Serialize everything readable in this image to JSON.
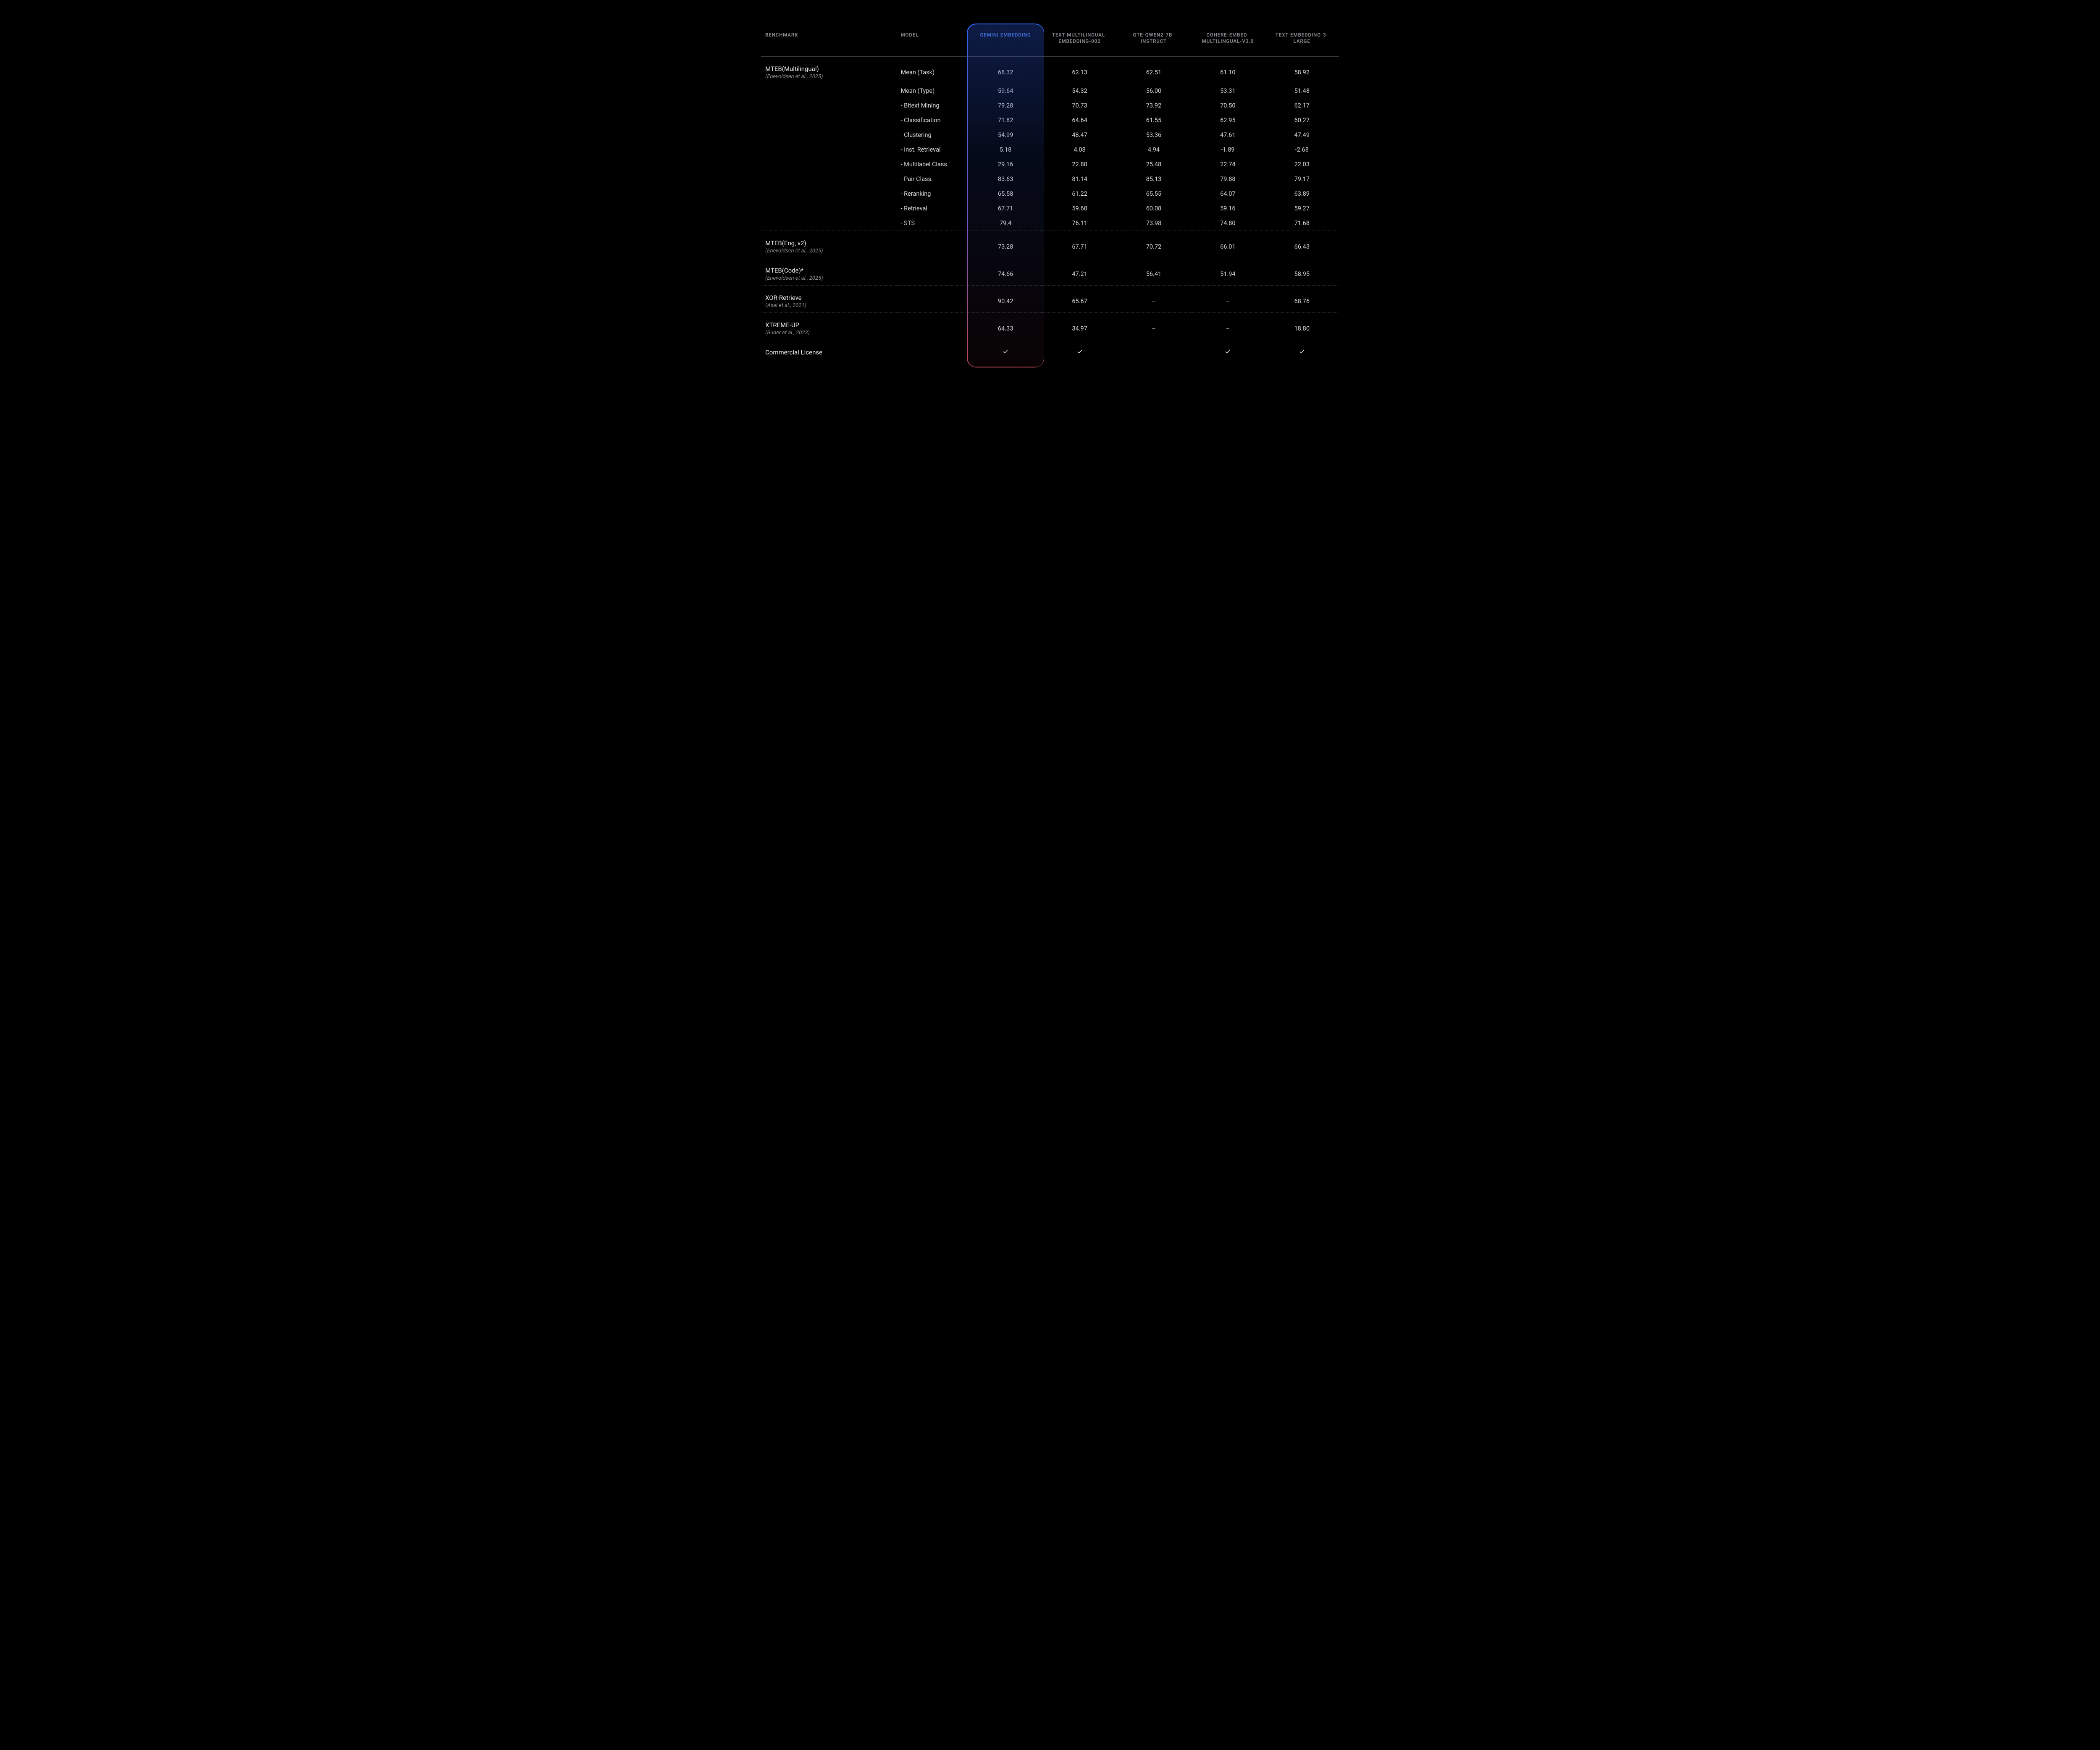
{
  "headers": {
    "benchmark": "BENCHMARK",
    "model": "MODEL",
    "cols": [
      "GEMINI EMBEDDING",
      "text-multilingual-embedding-002",
      "gte-Qwen2-7B-instruct",
      "Cohere-embed-multilingual-v3.0",
      "text-embedding-3-large"
    ]
  },
  "groups": [
    {
      "title": "MTEB(Multilingual)",
      "sub": "(Enevoldsen et al., 2025)",
      "rows": [
        {
          "label": "Mean (Task)",
          "vals": [
            "68.32",
            "62.13",
            "62.51",
            "61.10",
            "58.92"
          ]
        },
        {
          "label": "Mean (Type)",
          "vals": [
            "59.64",
            "54.32",
            "56.00",
            "53.31",
            "51.48"
          ]
        },
        {
          "label": "- Bitext Mining",
          "vals": [
            "79.28",
            "70.73",
            "73.92",
            "70.50",
            "62.17"
          ]
        },
        {
          "label": "- Classification",
          "vals": [
            "71.82",
            "64.64",
            "61.55",
            "62.95",
            "60.27"
          ]
        },
        {
          "label": "- Clustering",
          "vals": [
            "54.99",
            "48.47",
            "53.36",
            "47.61",
            "47.49"
          ]
        },
        {
          "label": "- Inst. Retrieval",
          "vals": [
            "5.18",
            "4.08",
            "4.94",
            "-1.89",
            "-2.68"
          ]
        },
        {
          "label": "- Multilabel Class.",
          "vals": [
            "29.16",
            "22.80",
            "25.48",
            "22.74",
            "22.03"
          ]
        },
        {
          "label": "- Pair Class.",
          "vals": [
            "83.63",
            "81.14",
            "85.13",
            "79.88",
            "79.17"
          ]
        },
        {
          "label": "- Reranking",
          "vals": [
            "65.58",
            "61.22",
            "65.55",
            "64.07",
            "63.89"
          ]
        },
        {
          "label": "- Retrieval",
          "vals": [
            "67.71",
            "59.68",
            "60.08",
            "59.16",
            "59.27"
          ]
        },
        {
          "label": "- STS",
          "vals": [
            "79.4",
            "76.11",
            "73.98",
            "74.80",
            "71.68"
          ]
        }
      ]
    },
    {
      "title": "MTEB(Eng, v2)",
      "sub": "(Enevoldsen et al., 2025)",
      "rows": [
        {
          "label": "",
          "vals": [
            "73.28",
            "67.71",
            "70.72",
            "66.01",
            "66.43"
          ]
        }
      ]
    },
    {
      "title": "MTEB(Code)*",
      "sub": "(Enevoldsen et al., 2025)",
      "rows": [
        {
          "label": "",
          "vals": [
            "74.66",
            "47.21",
            "56.41",
            "51.94",
            "58.95"
          ]
        }
      ]
    },
    {
      "title": "XOR-Retrieve",
      "sub": "(Asai et al., 2021)",
      "rows": [
        {
          "label": "",
          "vals": [
            "90.42",
            "65.67",
            "–",
            "–",
            "68.76"
          ]
        }
      ]
    },
    {
      "title": "XTREME-UP",
      "sub": "(Ruder et al., 2023)",
      "rows": [
        {
          "label": "",
          "vals": [
            "64.33",
            "34.97",
            "–",
            "–",
            "18.80"
          ]
        }
      ]
    },
    {
      "title": "Commercial License",
      "sub": "",
      "rows": [
        {
          "label": "",
          "vals": [
            "✓",
            "✓",
            "",
            "✓",
            "✓"
          ],
          "check": true
        }
      ]
    }
  ],
  "chart_data": {
    "type": "table",
    "title": "Embedding model benchmark comparison",
    "columns": [
      "GEMINI EMBEDDING",
      "text-multilingual-embedding-002",
      "gte-Qwen2-7B-instruct",
      "Cohere-embed-multilingual-v3.0",
      "text-embedding-3-large"
    ],
    "rows": [
      {
        "benchmark": "MTEB(Multilingual) Mean (Task)",
        "values": [
          68.32,
          62.13,
          62.51,
          61.1,
          58.92
        ]
      },
      {
        "benchmark": "MTEB(Multilingual) Mean (Type)",
        "values": [
          59.64,
          54.32,
          56.0,
          53.31,
          51.48
        ]
      },
      {
        "benchmark": "MTEB(Multilingual) Bitext Mining",
        "values": [
          79.28,
          70.73,
          73.92,
          70.5,
          62.17
        ]
      },
      {
        "benchmark": "MTEB(Multilingual) Classification",
        "values": [
          71.82,
          64.64,
          61.55,
          62.95,
          60.27
        ]
      },
      {
        "benchmark": "MTEB(Multilingual) Clustering",
        "values": [
          54.99,
          48.47,
          53.36,
          47.61,
          47.49
        ]
      },
      {
        "benchmark": "MTEB(Multilingual) Inst. Retrieval",
        "values": [
          5.18,
          4.08,
          4.94,
          -1.89,
          -2.68
        ]
      },
      {
        "benchmark": "MTEB(Multilingual) Multilabel Class.",
        "values": [
          29.16,
          22.8,
          25.48,
          22.74,
          22.03
        ]
      },
      {
        "benchmark": "MTEB(Multilingual) Pair Class.",
        "values": [
          83.63,
          81.14,
          85.13,
          79.88,
          79.17
        ]
      },
      {
        "benchmark": "MTEB(Multilingual) Reranking",
        "values": [
          65.58,
          61.22,
          65.55,
          64.07,
          63.89
        ]
      },
      {
        "benchmark": "MTEB(Multilingual) Retrieval",
        "values": [
          67.71,
          59.68,
          60.08,
          59.16,
          59.27
        ]
      },
      {
        "benchmark": "MTEB(Multilingual) STS",
        "values": [
          79.4,
          76.11,
          73.98,
          74.8,
          71.68
        ]
      },
      {
        "benchmark": "MTEB(Eng, v2)",
        "values": [
          73.28,
          67.71,
          70.72,
          66.01,
          66.43
        ]
      },
      {
        "benchmark": "MTEB(Code)*",
        "values": [
          74.66,
          47.21,
          56.41,
          51.94,
          58.95
        ]
      },
      {
        "benchmark": "XOR-Retrieve",
        "values": [
          90.42,
          65.67,
          null,
          null,
          68.76
        ]
      },
      {
        "benchmark": "XTREME-UP",
        "values": [
          64.33,
          34.97,
          null,
          null,
          18.8
        ]
      },
      {
        "benchmark": "Commercial License",
        "values": [
          true,
          true,
          false,
          true,
          true
        ]
      }
    ]
  }
}
